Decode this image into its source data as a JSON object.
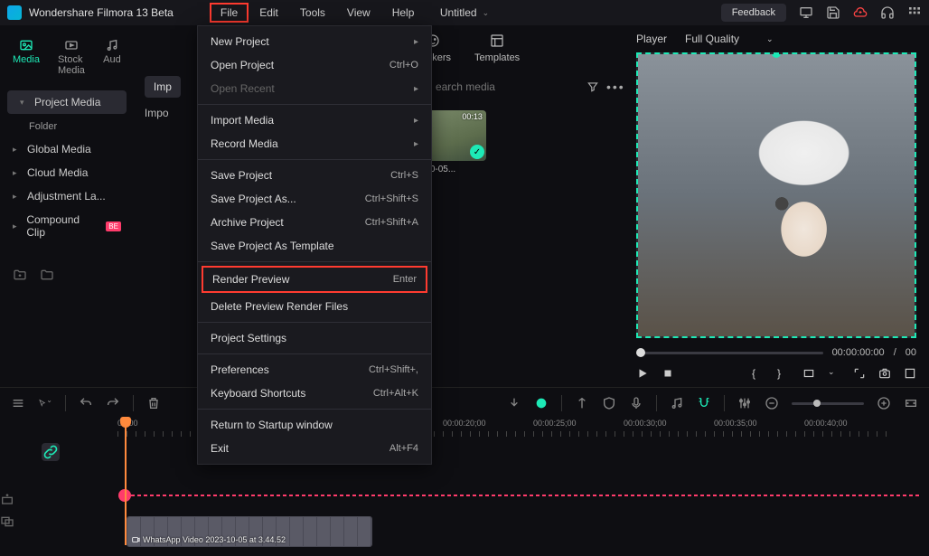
{
  "app": {
    "title": "Wondershare Filmora 13 Beta",
    "doc_title": "Untitled"
  },
  "menubar": [
    "File",
    "Edit",
    "Tools",
    "View",
    "Help"
  ],
  "titlebar": {
    "feedback": "Feedback"
  },
  "media_tabs": [
    {
      "label": "Media",
      "active": true
    },
    {
      "label": "Stock Media",
      "active": false
    },
    {
      "label": "Aud",
      "active": false
    }
  ],
  "sidebar": {
    "project_media": "Project Media",
    "folder": "Folder",
    "items": [
      "Global Media",
      "Cloud Media",
      "Adjustment La...",
      "Compound Clip"
    ]
  },
  "content": {
    "tabs": [
      "Stickers",
      "Templates"
    ],
    "import": "Imp",
    "import_full": "Impo",
    "search_placeholder": "earch media",
    "clip": {
      "duration": "00:13",
      "label": "...10-05..."
    }
  },
  "file_menu": [
    {
      "label": "New Project",
      "shortcut": "",
      "arrow": true
    },
    {
      "label": "Open Project",
      "shortcut": "Ctrl+O"
    },
    {
      "label": "Open Recent",
      "shortcut": "",
      "arrow": true,
      "disabled": true
    },
    {
      "sep": true
    },
    {
      "label": "Import Media",
      "shortcut": "",
      "arrow": true
    },
    {
      "label": "Record Media",
      "shortcut": "",
      "arrow": true
    },
    {
      "sep": true
    },
    {
      "label": "Save Project",
      "shortcut": "Ctrl+S"
    },
    {
      "label": "Save Project As...",
      "shortcut": "Ctrl+Shift+S"
    },
    {
      "label": "Archive Project",
      "shortcut": "Ctrl+Shift+A"
    },
    {
      "label": "Save Project As Template"
    },
    {
      "sep": true
    },
    {
      "label": "Render Preview",
      "shortcut": "Enter",
      "highlight": true
    },
    {
      "label": "Delete Preview Render Files"
    },
    {
      "sep": true
    },
    {
      "label": "Project Settings"
    },
    {
      "sep": true
    },
    {
      "label": "Preferences",
      "shortcut": "Ctrl+Shift+,"
    },
    {
      "label": "Keyboard Shortcuts",
      "shortcut": "Ctrl+Alt+K"
    },
    {
      "sep": true
    },
    {
      "label": "Return to Startup window"
    },
    {
      "label": "Exit",
      "shortcut": "Alt+F4"
    }
  ],
  "player": {
    "label": "Player",
    "quality": "Full Quality",
    "time_current": "00:00:00:00",
    "time_sep": "/",
    "time_total": "00"
  },
  "timeline": {
    "marks": [
      "00:00",
      "00:00:20;00",
      "00:00:25;00",
      "00:00:30;00",
      "00:00:35;00",
      "00:00:40;00"
    ],
    "clip_label": "WhatsApp Video 2023-10-05 at 3.44.52"
  }
}
